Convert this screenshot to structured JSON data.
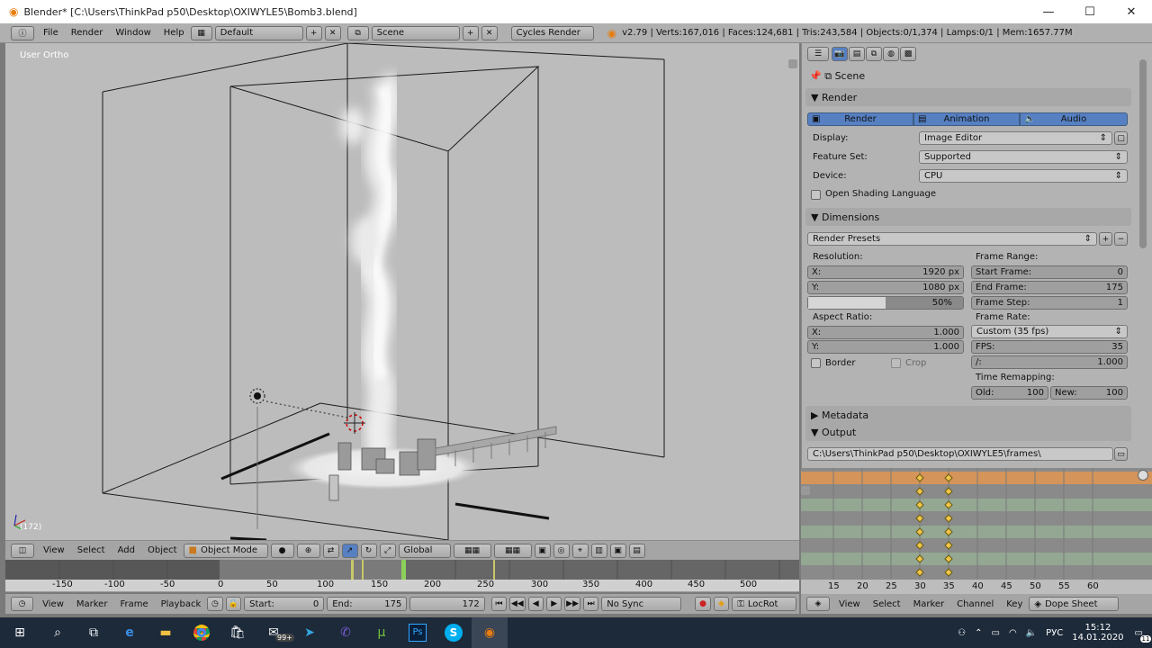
{
  "window": {
    "title": "Blender* [C:\\Users\\ThinkPad p50\\Desktop\\OXIWYLE5\\Bomb3.blend]"
  },
  "menu": [
    "File",
    "Render",
    "Window",
    "Help"
  ],
  "header": {
    "screen": "Default",
    "scene": "Scene",
    "engine": "Cycles Render",
    "stats": "v2.79 | Verts:167,016 | Faces:124,681 | Tris:243,584 | Objects:0/1,374 | Lamps:0/1 | Mem:1657.77M"
  },
  "viewport": {
    "label": "User Ortho",
    "frame": "(172)",
    "menu": [
      "View",
      "Select",
      "Add",
      "Object"
    ],
    "mode": "Object Mode",
    "orientation": "Global"
  },
  "timeline": {
    "ruler": [
      "-150",
      "-100",
      "-50",
      "0",
      "50",
      "100",
      "150",
      "200",
      "250",
      "300",
      "350",
      "400",
      "450",
      "500"
    ],
    "menu": [
      "View",
      "Marker",
      "Frame",
      "Playback"
    ],
    "start_label": "Start:",
    "start": "0",
    "end_label": "End:",
    "end": "175",
    "current": "172",
    "sync": "No Sync",
    "keying": "LocRot"
  },
  "properties": {
    "context": "Scene",
    "render_panel": "Render",
    "render_btn": "Render",
    "animation_btn": "Animation",
    "audio_btn": "Audio",
    "display_label": "Display:",
    "display": "Image Editor",
    "feature_label": "Feature Set:",
    "feature": "Supported",
    "device_label": "Device:",
    "device": "CPU",
    "osl": "Open Shading Language",
    "dimensions_panel": "Dimensions",
    "presets": "Render Presets",
    "resolution_label": "Resolution:",
    "res_x_label": "X:",
    "res_x": "1920 px",
    "res_y_label": "Y:",
    "res_y": "1080 px",
    "res_pct": "50%",
    "res_pct_value": 0.5,
    "frame_range_label": "Frame Range:",
    "start_frame_label": "Start Frame:",
    "start_frame": "0",
    "end_frame_label": "End Frame:",
    "end_frame": "175",
    "frame_step_label": "Frame Step:",
    "frame_step": "1",
    "aspect_label": "Aspect Ratio:",
    "asp_x_label": "X:",
    "asp_x": "1.000",
    "asp_y_label": "Y:",
    "asp_y": "1.000",
    "frame_rate_label": "Frame Rate:",
    "frame_rate": "Custom (35 fps)",
    "fps_label": "FPS:",
    "fps": "35",
    "base_label": "/:",
    "base": "1.000",
    "border": "Border",
    "crop": "Crop",
    "remap_label": "Time Remapping:",
    "old_label": "Old:",
    "old": "100",
    "new_label": "New:",
    "new": "100",
    "metadata_panel": "Metadata",
    "output_panel": "Output",
    "output_path": "C:\\Users\\ThinkPad p50\\Desktop\\OXIWYLE5\\frames\\"
  },
  "dopesheet": {
    "ruler": [
      "15",
      "20",
      "25",
      "30",
      "35",
      "40",
      "45",
      "50",
      "55",
      "60"
    ],
    "menu": [
      "View",
      "Select",
      "Marker",
      "Channel",
      "Key"
    ],
    "mode": "Dope Sheet"
  },
  "taskbar": {
    "badge": "99+",
    "lang": "РУС",
    "time": "15:12",
    "date": "14.01.2020",
    "notif": "11"
  },
  "colors": {
    "accent": "#5680c2",
    "selected_row": "#d4945a",
    "keyframe": "#f0c64a"
  }
}
